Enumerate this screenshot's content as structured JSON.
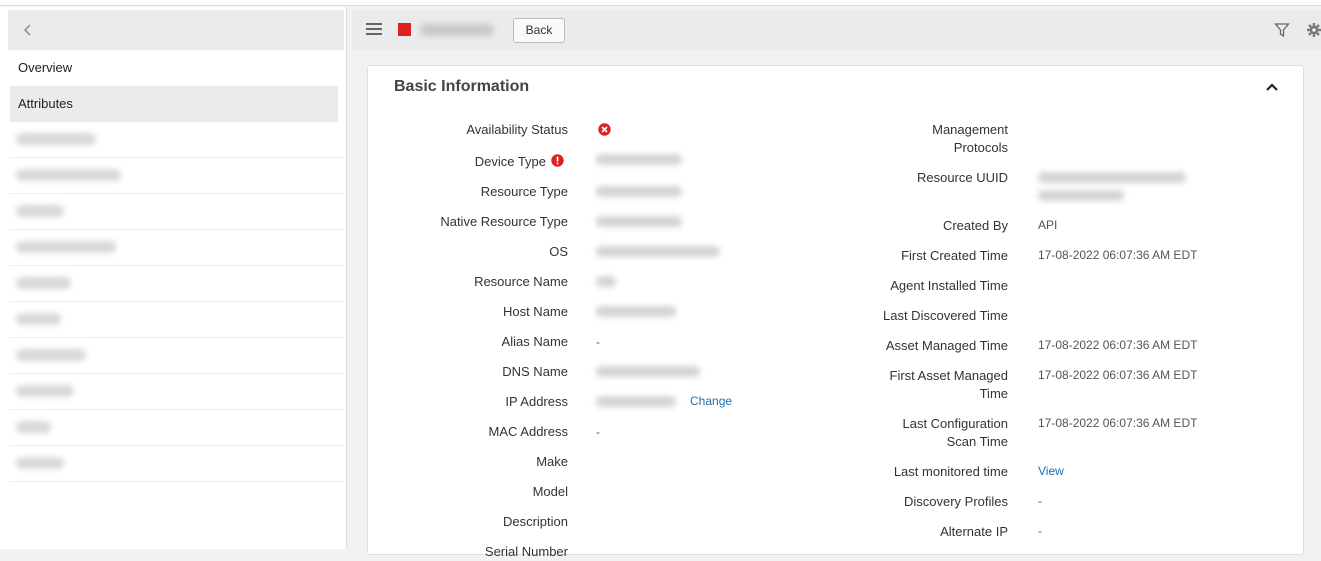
{
  "nav": {
    "items": [
      {
        "label": "Overview",
        "active": false
      },
      {
        "label": "Attributes",
        "active": true
      }
    ]
  },
  "header": {
    "back_label": "Back"
  },
  "card": {
    "title": "Basic Information"
  },
  "left_fields": [
    {
      "label": "Availability Status",
      "value": ""
    },
    {
      "label": "Device Type",
      "value": ""
    },
    {
      "label": "Resource Type",
      "value": ""
    },
    {
      "label": "Native Resource Type",
      "value": ""
    },
    {
      "label": "OS",
      "value": ""
    },
    {
      "label": "Resource Name",
      "value": ""
    },
    {
      "label": "Host Name",
      "value": ""
    },
    {
      "label": "Alias Name",
      "value": "-"
    },
    {
      "label": "DNS Name",
      "value": ""
    },
    {
      "label": "IP Address",
      "value": "",
      "link": "Change"
    },
    {
      "label": "MAC Address",
      "value": "-"
    },
    {
      "label": "Make",
      "value": ""
    },
    {
      "label": "Model",
      "value": ""
    },
    {
      "label": "Description",
      "value": ""
    },
    {
      "label": "Serial Number",
      "value": ""
    }
  ],
  "right_fields": [
    {
      "label": "Management Protocols",
      "value": ""
    },
    {
      "label": "Resource UUID",
      "value": ""
    },
    {
      "label": "Created By",
      "value": "API"
    },
    {
      "label": "First Created Time",
      "value": "17-08-2022 06:07:36 AM EDT"
    },
    {
      "label": "Agent Installed Time",
      "value": ""
    },
    {
      "label": "Last Discovered Time",
      "value": ""
    },
    {
      "label": "Asset Managed Time",
      "value": "17-08-2022 06:07:36 AM EDT"
    },
    {
      "label": "First Asset Managed Time",
      "value": "17-08-2022 06:07:36 AM EDT"
    },
    {
      "label": "Last Configuration Scan Time",
      "value": "17-08-2022 06:07:36 AM EDT"
    },
    {
      "label": "Last monitored time",
      "value": "",
      "link": "View"
    },
    {
      "label": "Discovery Profiles",
      "value": "-"
    },
    {
      "label": "Alternate IP",
      "value": "-"
    }
  ],
  "colors": {
    "status_down": "#e02020",
    "link": "#1a6fae",
    "panel_gray": "#ebebeb"
  }
}
